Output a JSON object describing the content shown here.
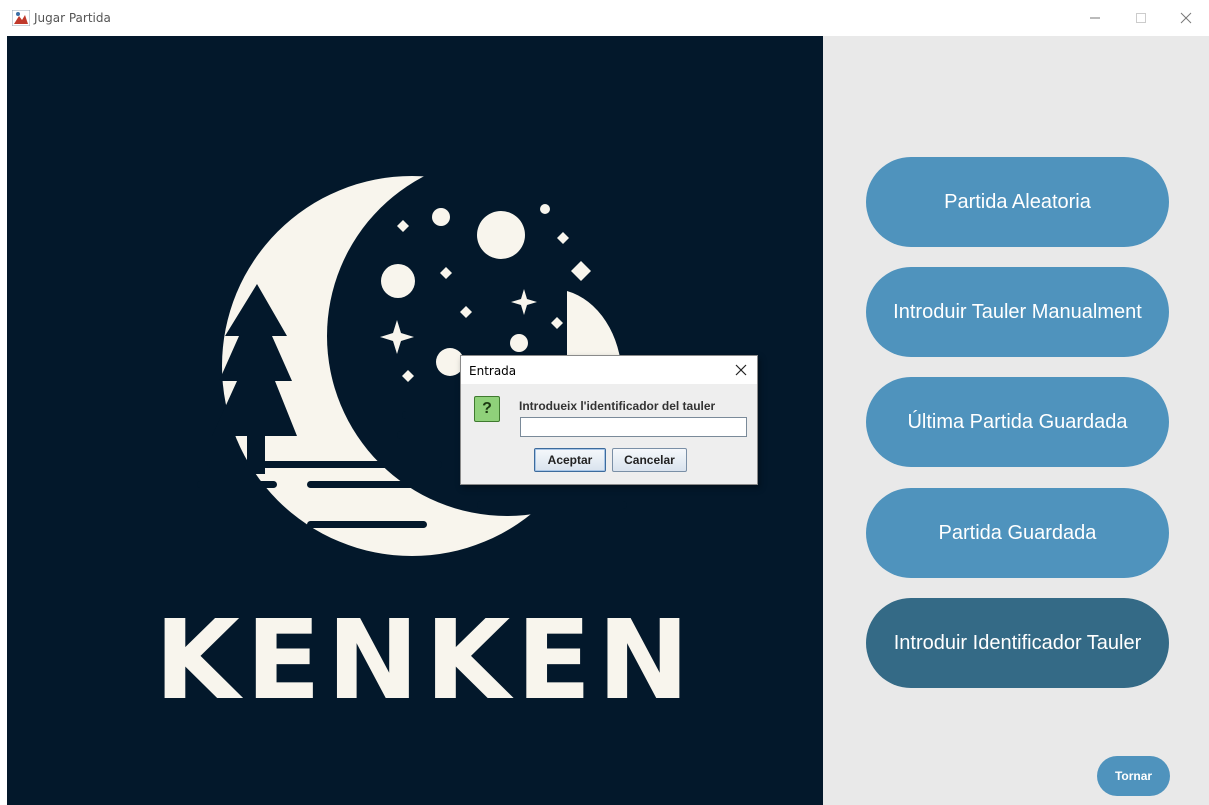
{
  "window": {
    "title": "Jugar Partida"
  },
  "logo": {
    "wordmark": "KENKEN"
  },
  "menu": {
    "buttons": [
      "Partida Aleatoria",
      "Introduir Tauler Manualment",
      "Última Partida Guardada",
      "Partida Guardada",
      "Introduir Identificador Tauler"
    ],
    "back_label": "Tornar"
  },
  "dialog": {
    "title": "Entrada",
    "message": "Introdueix l'identificador del tauler",
    "input_value": "",
    "accept_label": "Aceptar",
    "cancel_label": "Cancelar",
    "icon_glyph": "?"
  },
  "colors": {
    "logo_background": "#03182b",
    "logo_foreground": "#f8f5ed",
    "button": "#4f93bd",
    "button_active": "#346a86",
    "side_panel": "#e9e9e9"
  }
}
